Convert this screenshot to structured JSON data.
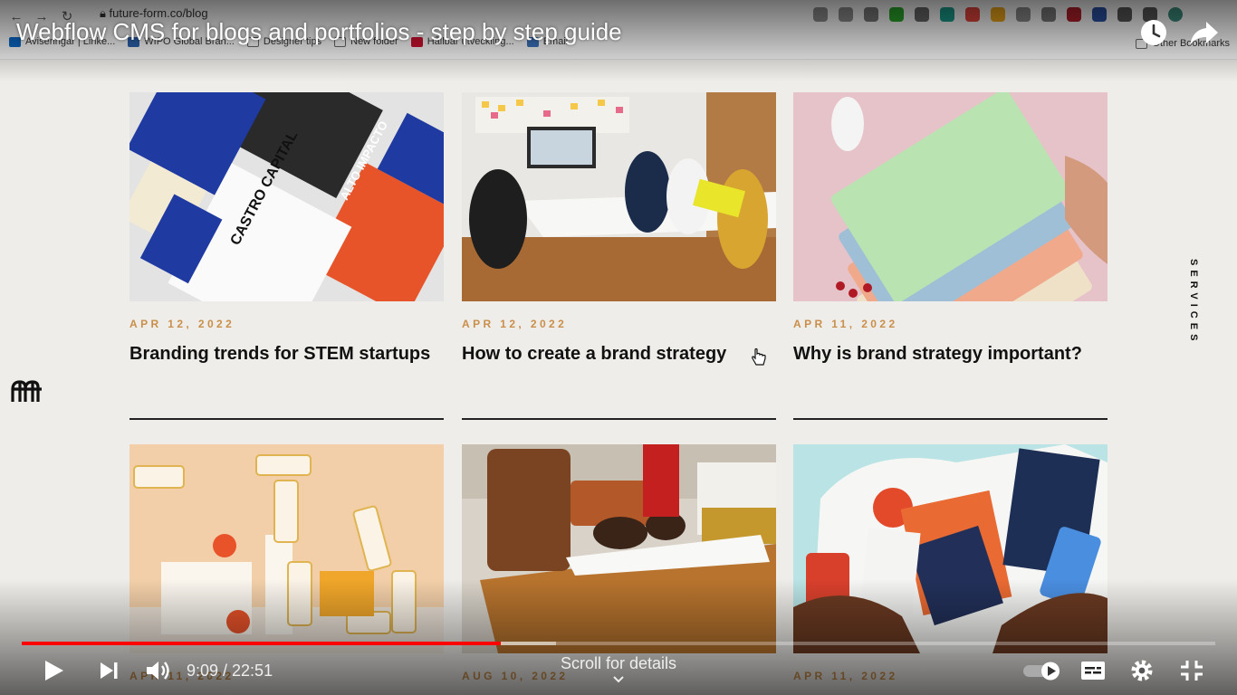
{
  "browser": {
    "url": "future-form.co/blog",
    "bookmarks": [
      "Aviseringar | Linke...",
      "WIPO Global Bran...",
      "Designer tips",
      "New folder",
      "Hållbar utveckling...",
      "Email"
    ],
    "other_bookmarks": "Other Bookmarks"
  },
  "video": {
    "title": "Webflow CMS for blogs and portfolios - step by step guide",
    "time": "9:09 / 22:51",
    "scroll_hint": "Scroll for details",
    "progress": 0.401,
    "buffered": 0.448
  },
  "site": {
    "side_label": "SERVICES",
    "posts": [
      {
        "date": "APR 12, 2022",
        "title": "Branding trends for STEM startups"
      },
      {
        "date": "APR 12, 2022",
        "title": "How to create a brand strategy"
      },
      {
        "date": "APR 11, 2022",
        "title": "Why is brand strategy important?"
      },
      {
        "date": "APR 11, 2022",
        "title": ""
      },
      {
        "date": "AUG 10, 2022",
        "title": ""
      },
      {
        "date": "APR 11, 2022",
        "title": ""
      }
    ]
  },
  "colors": {
    "accent_date": "#c98f4a",
    "progress": "#ff0000",
    "background": "#efede9"
  }
}
